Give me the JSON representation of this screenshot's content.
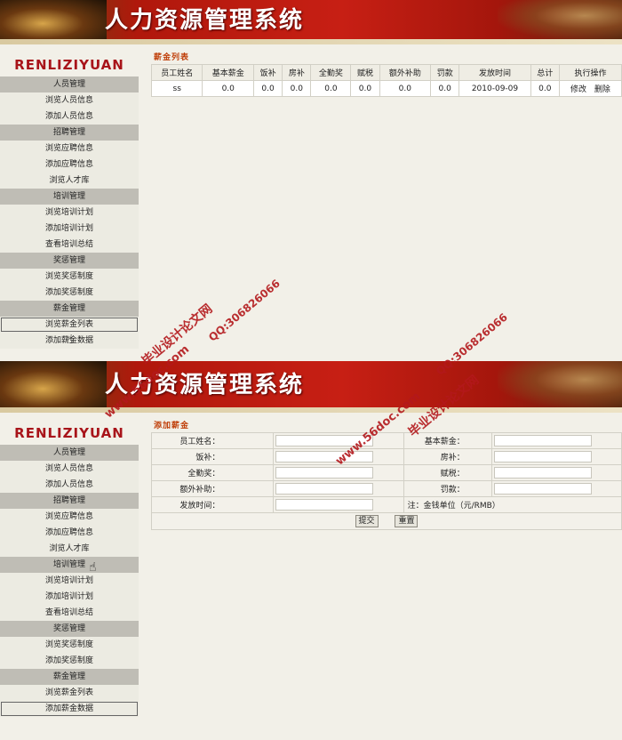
{
  "banner": {
    "title": "人力资源管理系统"
  },
  "sidebar": {
    "logo": "RENLIZIYUAN",
    "groups": [
      {
        "header": "人员管理",
        "items": [
          "浏览人员信息",
          "添加人员信息"
        ]
      },
      {
        "header": "招聘管理",
        "items": [
          "浏览应聘信息",
          "添加应聘信息",
          "浏览人才库"
        ]
      },
      {
        "header": "培训管理",
        "items": [
          "浏览培训计划",
          "添加培训计划",
          "查看培训总结"
        ]
      },
      {
        "header": "奖惩管理",
        "items": [
          "浏览奖惩制度",
          "添加奖惩制度"
        ]
      },
      {
        "header": "薪金管理",
        "items": [
          "浏览薪金列表",
          "添加薪金数据"
        ]
      }
    ]
  },
  "salary_list": {
    "title": "薪金列表",
    "columns": [
      "员工姓名",
      "基本薪金",
      "饭补",
      "房补",
      "全勤奖",
      "赋税",
      "额外补助",
      "罚款",
      "发放时间",
      "总计",
      "执行操作"
    ],
    "rows": [
      {
        "name": "ss",
        "base": "0.0",
        "meal": "0.0",
        "housing": "0.0",
        "attendance": "0.0",
        "tax": "0.0",
        "extra": "0.0",
        "fine": "0.0",
        "date": "2010-09-09",
        "total": "0.0",
        "edit": "修改",
        "delete": "删除"
      }
    ]
  },
  "add_salary": {
    "title": "添加薪金",
    "fields": {
      "name": "员工姓名：",
      "base": "基本薪金：",
      "meal": "饭补：",
      "housing": "房补：",
      "attendance": "全勤奖：",
      "tax": "赋税：",
      "extra": "额外补助：",
      "fine": "罚款：",
      "date": "发放时间："
    },
    "note": "注：金钱单位（元/RMB）",
    "submit_label": "提交",
    "reset_label": "重置"
  },
  "watermarks": {
    "site": "www.56doc.com",
    "qq": "QQ:306826066",
    "name": "毕业设计论文网"
  }
}
